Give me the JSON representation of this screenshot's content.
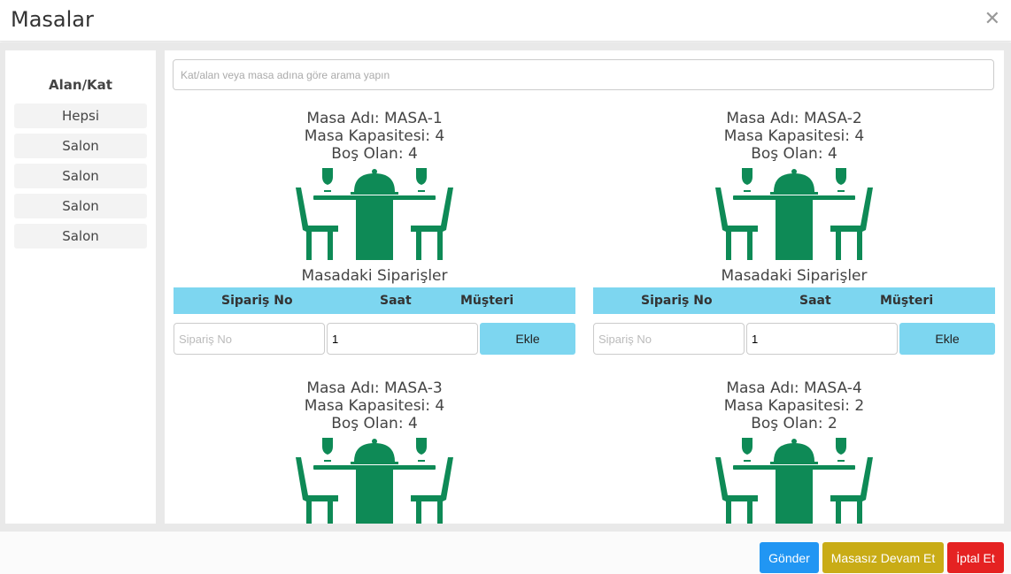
{
  "window": {
    "title": "Masalar",
    "close_glyph": "✕"
  },
  "sidebar": {
    "title": "Alan/Kat",
    "items": [
      {
        "label": "Hepsi"
      },
      {
        "label": "Salon"
      },
      {
        "label": "Salon"
      },
      {
        "label": "Salon"
      },
      {
        "label": "Salon"
      }
    ]
  },
  "search": {
    "placeholder": "Kat/alan veya masa adına göre arama yapın",
    "value": ""
  },
  "tables": [
    {
      "name_line": "Masa Adı: MASA-1",
      "capacity_line": "Masa Kapasitesi: 4",
      "free_line": "Boş Olan: 4"
    },
    {
      "name_line": "Masa Adı: MASA-2",
      "capacity_line": "Masa Kapasitesi: 4",
      "free_line": "Boş Olan: 4"
    },
    {
      "name_line": "Masa Adı: MASA-3",
      "capacity_line": "Masa Kapasitesi: 4",
      "free_line": "Boş Olan: 4"
    },
    {
      "name_line": "Masa Adı: MASA-4",
      "capacity_line": "Masa Kapasitesi: 2",
      "free_line": "Boş Olan: 2"
    }
  ],
  "orders": {
    "title": "Masadaki Siparişler",
    "columns": [
      "Sipariş No",
      "Saat",
      "Müşteri"
    ],
    "order_placeholder": "Sipariş No",
    "quantity_value": "1",
    "add_label": "Ekle"
  },
  "footer": {
    "send_label": "Gönder",
    "continue_label": "Masasız Devam Et",
    "cancel_label": "İptal Et"
  },
  "colors": {
    "accent_light_blue": "#7dd6f0",
    "table_icon_green": "#0e8a56",
    "send_button": "#2196f3",
    "continue_button": "#c9ac16",
    "cancel_button": "#e52222"
  },
  "icons": {
    "table": "dining-table-icon",
    "close": "close-icon"
  }
}
